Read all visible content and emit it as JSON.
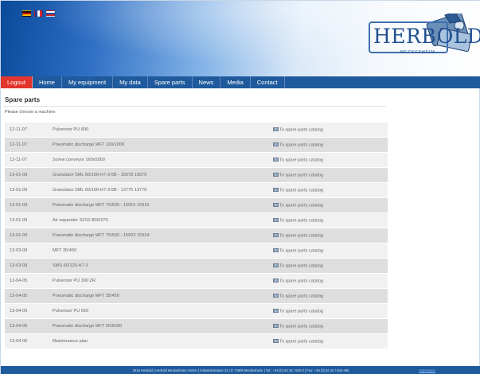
{
  "languages": [
    "German",
    "French",
    "Russian"
  ],
  "brand": {
    "name": "HERBOLD",
    "subtitle": "MECKESHEIM"
  },
  "nav": {
    "items": [
      "Logout",
      "Home",
      "My equipment",
      "My data",
      "Spare parts",
      "News",
      "Media",
      "Contact"
    ],
    "active": "Logout"
  },
  "page": {
    "title": "Spare parts",
    "prompt": "Please choose a machine:"
  },
  "table": {
    "rows": [
      {
        "date": "12-11-07",
        "name": "Pulverizer PU 800",
        "link": "To spare parts catalog"
      },
      {
        "date": "12-11-07",
        "name": "Pneumatic discharge MFT 100/1000",
        "link": "To spare parts catalog"
      },
      {
        "date": "12-11-07",
        "name": "Screw conveyor 160x5900",
        "link": "To spare parts catalog"
      },
      {
        "date": "13-01-09",
        "name": "Granulator SML 60/100-H7-3-5B - 15678 15679",
        "link": "To spare parts catalog"
      },
      {
        "date": "13-01-09",
        "name": "Granulator SML 60/100-H7-3-5B - 13775 13776",
        "link": "To spare parts catalog"
      },
      {
        "date": "13-01-09",
        "name": "Pneumatic discharge MFT 75/500 - 15915 15916",
        "link": "To spare parts catalog"
      },
      {
        "date": "13-01-09",
        "name": "Air separator SZS2-800/270",
        "link": "To spare parts catalog"
      },
      {
        "date": "13-01-09",
        "name": "Pneumatic discharge MFT 75/500 - 15923 15924",
        "link": "To spare parts catalog"
      },
      {
        "date": "13-03-09",
        "name": "MFT 35/450",
        "link": "To spare parts catalog"
      },
      {
        "date": "13-03-09",
        "name": "SMS 60/120-A7-3",
        "link": "To spare parts catalog"
      },
      {
        "date": "13-04-05",
        "name": "Pulverizer PU 300 ZR",
        "link": "To spare parts catalog"
      },
      {
        "date": "13-04-05",
        "name": "Pneumatic discharge MFT 35/450",
        "link": "To spare parts catalog"
      },
      {
        "date": "13-04-05",
        "name": "Pulverizer PU 650",
        "link": "To spare parts catalog"
      },
      {
        "date": "13-04-05",
        "name": "Pneumatic discharge MFT 55/5000",
        "link": "To spare parts catalog"
      },
      {
        "date": "13-04-05",
        "name": "Maintenance plan",
        "link": "To spare parts catalog"
      }
    ]
  },
  "footer": {
    "text": "2016 Herbold | Herbold Meckesheim GmbH | Industriestrasse 33 | D 74909 Meckesheim | Tel.: +49 (0) 62 26 / 932-0 | Fax: +49 (0) 62 26 / 932-495",
    "link": "Impressum"
  }
}
